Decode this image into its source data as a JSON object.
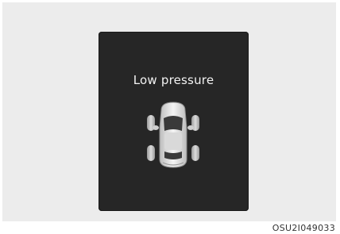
{
  "display": {
    "message": "Low pressure",
    "icon": "car-top-view-tire-pressure-icon",
    "status": "all tires low",
    "colors": {
      "screen": "#262626",
      "text": "#f2f2f2",
      "car_body": "#e8e8e8",
      "tire_indicator": "#c8c8c8"
    }
  },
  "figure_code": "OSU2I049033"
}
